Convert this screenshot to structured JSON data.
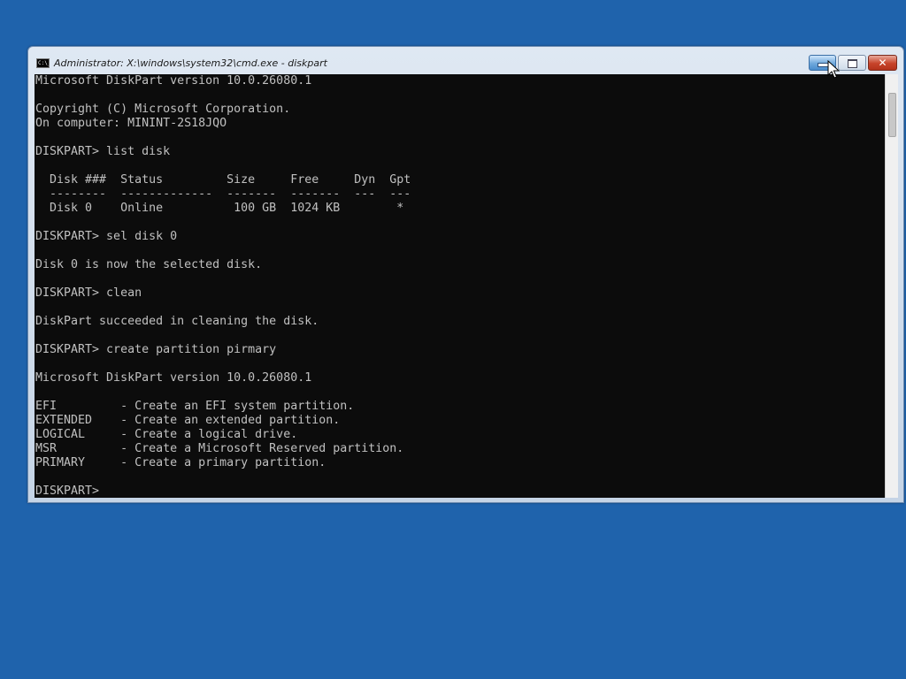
{
  "window": {
    "title": "Administrator: X:\\windows\\system32\\cmd.exe - diskpart",
    "icon": "cmd-icon",
    "icon_text": "C:\\_",
    "controls": {
      "minimize": "minimize-icon",
      "maximize": "maximize-icon",
      "close": "close-icon",
      "close_glyph": "✕"
    }
  },
  "console": {
    "lines": [
      "Microsoft DiskPart version 10.0.26080.1",
      "",
      "Copyright (C) Microsoft Corporation.",
      "On computer: MININT-2S18JQO",
      "",
      "DISKPART> list disk",
      "",
      "  Disk ###  Status         Size     Free     Dyn  Gpt",
      "  --------  -------------  -------  -------  ---  ---",
      "  Disk 0    Online          100 GB  1024 KB        *",
      "",
      "DISKPART> sel disk 0",
      "",
      "Disk 0 is now the selected disk.",
      "",
      "DISKPART> clean",
      "",
      "DiskPart succeeded in cleaning the disk.",
      "",
      "DISKPART> create partition pirmary",
      "",
      "Microsoft DiskPart version 10.0.26080.1",
      "",
      "EFI         - Create an EFI system partition.",
      "EXTENDED    - Create an extended partition.",
      "LOGICAL     - Create a logical drive.",
      "MSR         - Create a Microsoft Reserved partition.",
      "PRIMARY     - Create a primary partition.",
      "",
      "DISKPART>"
    ]
  },
  "colors": {
    "desktop": "#1f63ac",
    "console_bg": "#0c0c0c",
    "console_fg": "#c0c0c0"
  },
  "mouse_cursor": "arrow-cursor-icon"
}
